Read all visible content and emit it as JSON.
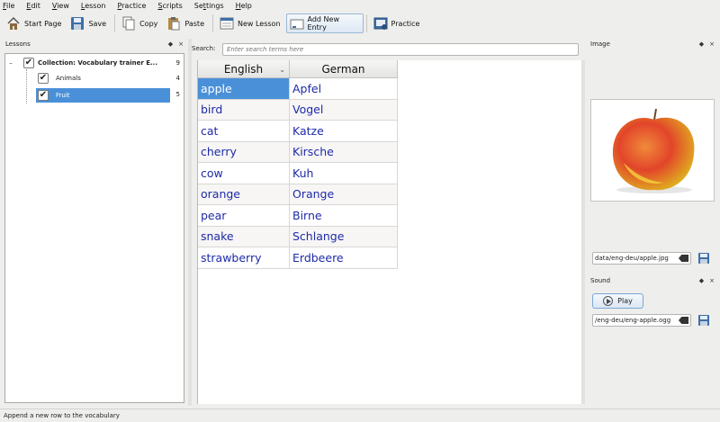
{
  "menu": [
    {
      "pre": "",
      "u": "F",
      "post": "ile"
    },
    {
      "pre": "",
      "u": "E",
      "post": "dit"
    },
    {
      "pre": "",
      "u": "V",
      "post": "iew"
    },
    {
      "pre": "",
      "u": "L",
      "post": "esson"
    },
    {
      "pre": "",
      "u": "P",
      "post": "ractice"
    },
    {
      "pre": "",
      "u": "S",
      "post": "cripts"
    },
    {
      "pre": "Se",
      "u": "t",
      "post": "tings"
    },
    {
      "pre": "",
      "u": "H",
      "post": "elp"
    }
  ],
  "toolbar": {
    "start_page": "Start Page",
    "save": "Save",
    "copy": "Copy",
    "paste": "Paste",
    "new_lesson": "New Lesson",
    "add_new_entry": "Add New Entry",
    "practice": "Practice"
  },
  "lessons_panel": {
    "title": "Lessons",
    "float_icon": "float-icon",
    "close_icon": "close-icon",
    "tree": {
      "collection_label": "Collection: Vocabulary trainer E...",
      "collection_count": "9",
      "expander": "–",
      "children": [
        {
          "label": "Animals",
          "count": "4",
          "selected": false
        },
        {
          "label": "Fruit",
          "count": "5",
          "selected": true
        }
      ]
    }
  },
  "search": {
    "label": "Search:",
    "placeholder": "Enter search terms here",
    "value": ""
  },
  "table": {
    "columns": [
      "English",
      "German"
    ],
    "sort_indicator": "⌄",
    "rows": [
      [
        "apple",
        "Apfel"
      ],
      [
        "bird",
        "Vogel"
      ],
      [
        "cat",
        "Katze"
      ],
      [
        "cherry",
        "Kirsche"
      ],
      [
        "cow",
        "Kuh"
      ],
      [
        "orange",
        "Orange"
      ],
      [
        "pear",
        "Birne"
      ],
      [
        "snake",
        "Schlange"
      ],
      [
        "strawberry",
        "Erdbeere"
      ]
    ],
    "selected_row": 0
  },
  "image_panel": {
    "title": "Image",
    "file_path": "data/eng-deu/apple.jpg",
    "image_subject": "apple-image"
  },
  "sound_panel": {
    "title": "Sound",
    "play_label": "Play",
    "file_path": "/eng-deu/eng-apple.ogg"
  },
  "status_bar": {
    "text": "Append a new row to the vocabulary"
  },
  "colors": {
    "selection": "#4a90d9",
    "entry_text": "#1e2aa8",
    "window_bg": "#eeeeec"
  }
}
